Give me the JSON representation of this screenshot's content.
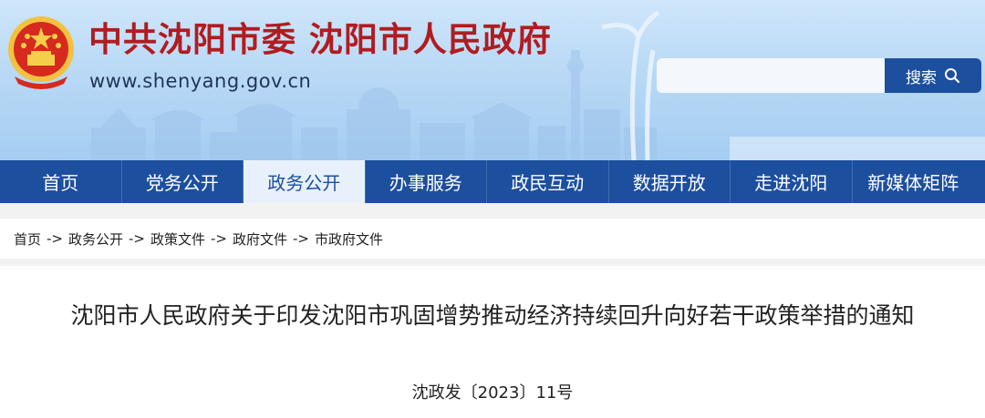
{
  "header": {
    "site_title": "中共沈阳市委  沈阳市人民政府",
    "site_url": "www.shenyang.gov.cn",
    "search": {
      "placeholder": "",
      "button_label": "搜索"
    }
  },
  "nav": {
    "items": [
      {
        "label": "首页"
      },
      {
        "label": "党务公开"
      },
      {
        "label": "政务公开",
        "active": true
      },
      {
        "label": "办事服务"
      },
      {
        "label": "政民互动"
      },
      {
        "label": "数据开放"
      },
      {
        "label": "走进沈阳"
      },
      {
        "label": "新媒体矩阵"
      }
    ]
  },
  "breadcrumb": {
    "items": [
      "首页",
      "政务公开",
      "政策文件",
      "政府文件",
      "市政府文件"
    ],
    "separator": "->"
  },
  "article": {
    "title": "沈阳市人民政府关于印发沈阳市巩固增势推动经济持续回升向好若干政策举措的通知",
    "doc_number": "沈政发〔2023〕11号"
  },
  "colors": {
    "nav_bg": "#1d4f9f",
    "nav_active_bg": "#e8f1fb",
    "title_red": "#b01c20"
  }
}
